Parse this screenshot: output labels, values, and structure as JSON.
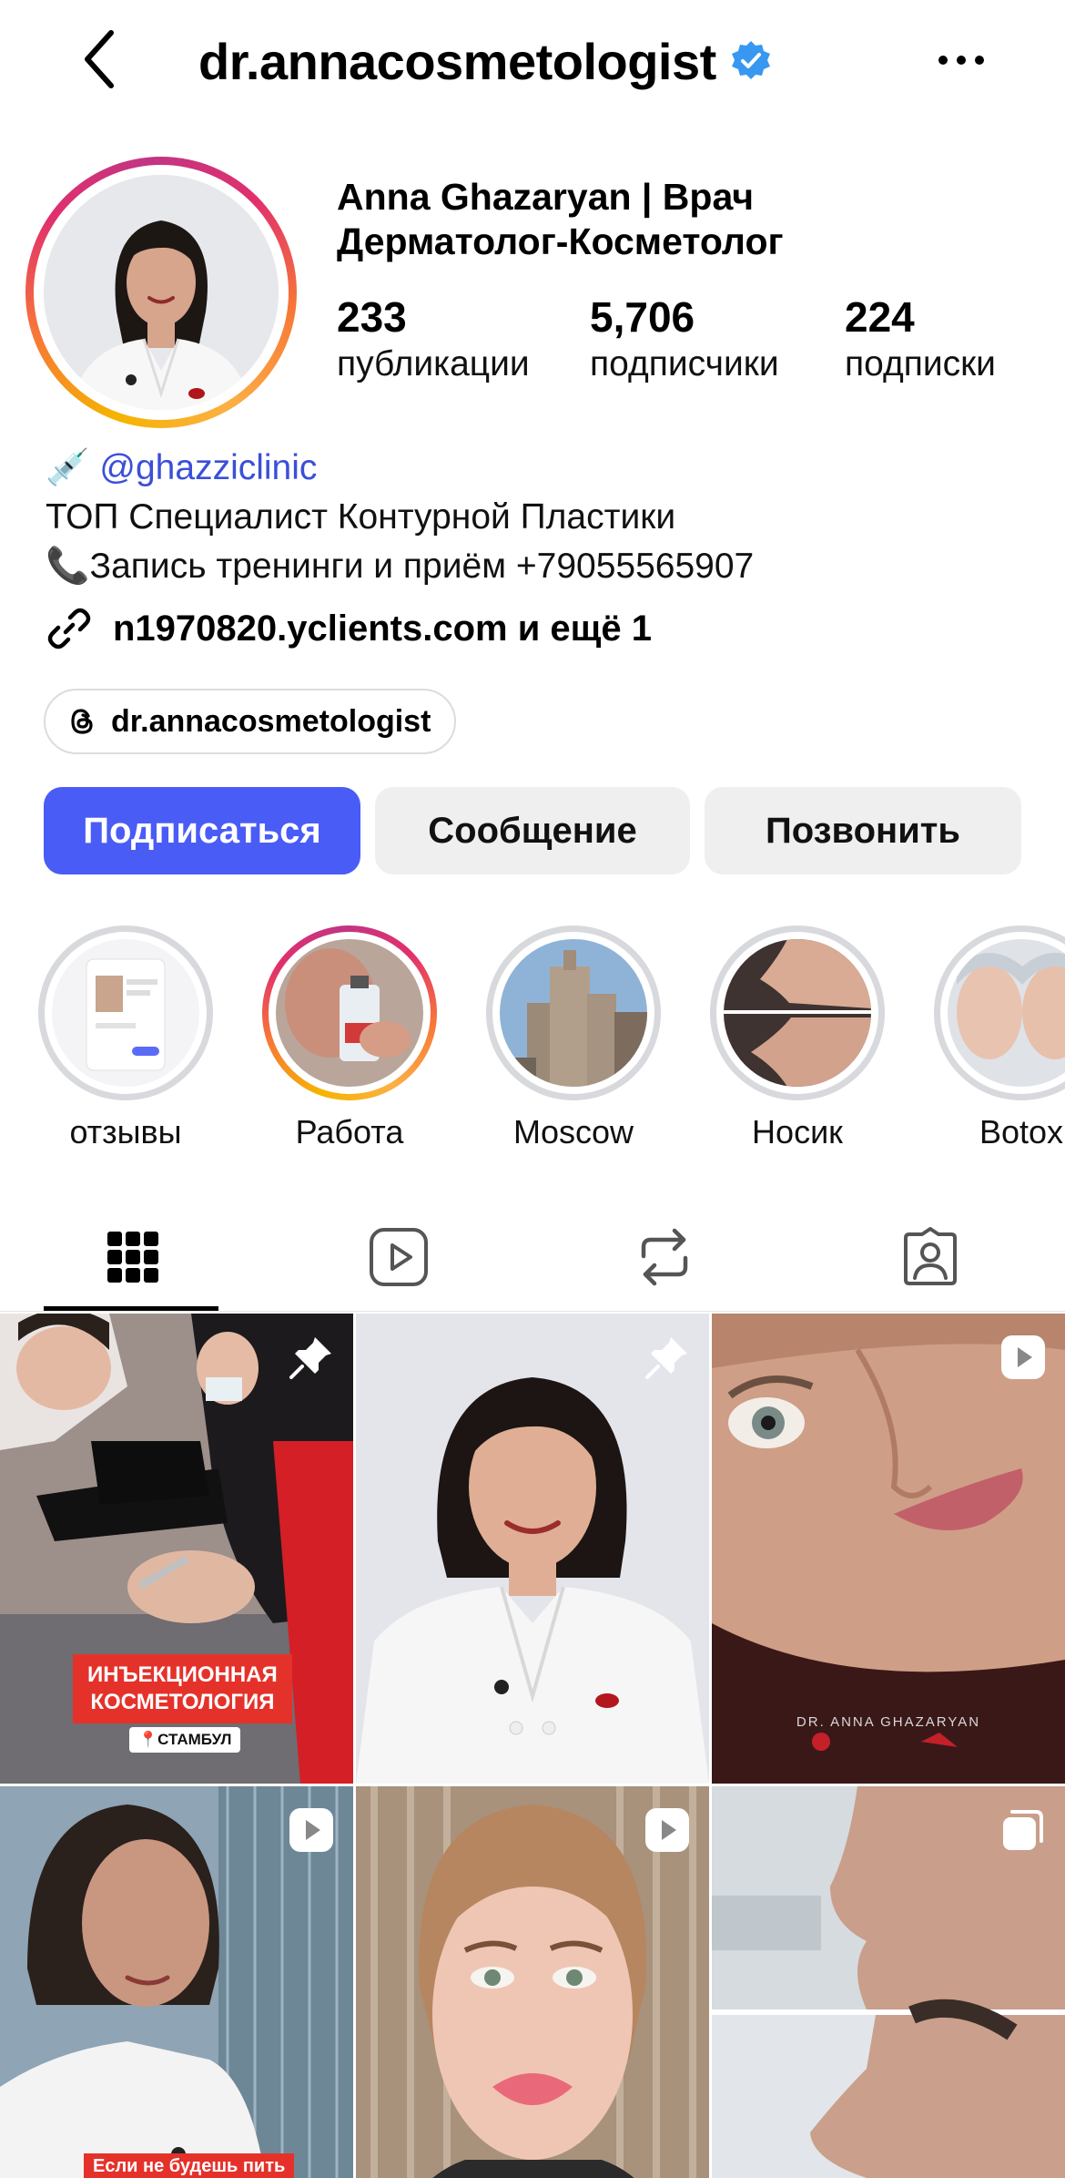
{
  "header": {
    "username": "dr.annacosmetologist",
    "verified": true
  },
  "profile": {
    "display_name_line1": "Anna Ghazaryan | Врач",
    "display_name_line2": "Дерматолог-Косметолог",
    "stats": [
      {
        "value": "233",
        "label": "публикации"
      },
      {
        "value": "5,706",
        "label": "подписчики"
      },
      {
        "value": "224",
        "label": "подписки"
      }
    ],
    "bio": {
      "mention_emoji": "💉",
      "mention": "@ghazziclinic",
      "line2": "ТОП Специалист Контурной Пластики",
      "line3": "📞Запись тренинги и приём  +79055565907"
    },
    "link_text": "n1970820.yclients.com и ещё 1",
    "threads_handle": "dr.annacosmetologist"
  },
  "actions": {
    "follow": "Подписаться",
    "message": "Сообщение",
    "call": "Позвонить"
  },
  "highlights": [
    {
      "label": "отзывы",
      "active": false
    },
    {
      "label": "Работа",
      "active": true
    },
    {
      "label": "Moscow",
      "active": false
    },
    {
      "label": "Носик",
      "active": false
    },
    {
      "label": "Botox",
      "active": false
    }
  ],
  "tabs": {
    "selected": "grid",
    "items": [
      "grid-icon",
      "reels-icon",
      "reposts-icon",
      "tagged-icon"
    ]
  },
  "posts": {
    "post1_caption": "ИНЪЕКЦИОННАЯ\nКОСМЕТОЛОГИЯ",
    "post1_location": "📍СТАМБУЛ",
    "post3_watermark": "DR. ANNA GHAZARYAN",
    "post4_caption": "Если не будешь пить",
    "badges": [
      "pin-icon",
      "pin-icon",
      "reel-icon",
      "reel-icon",
      "reel-icon",
      "carousel-icon"
    ]
  }
}
